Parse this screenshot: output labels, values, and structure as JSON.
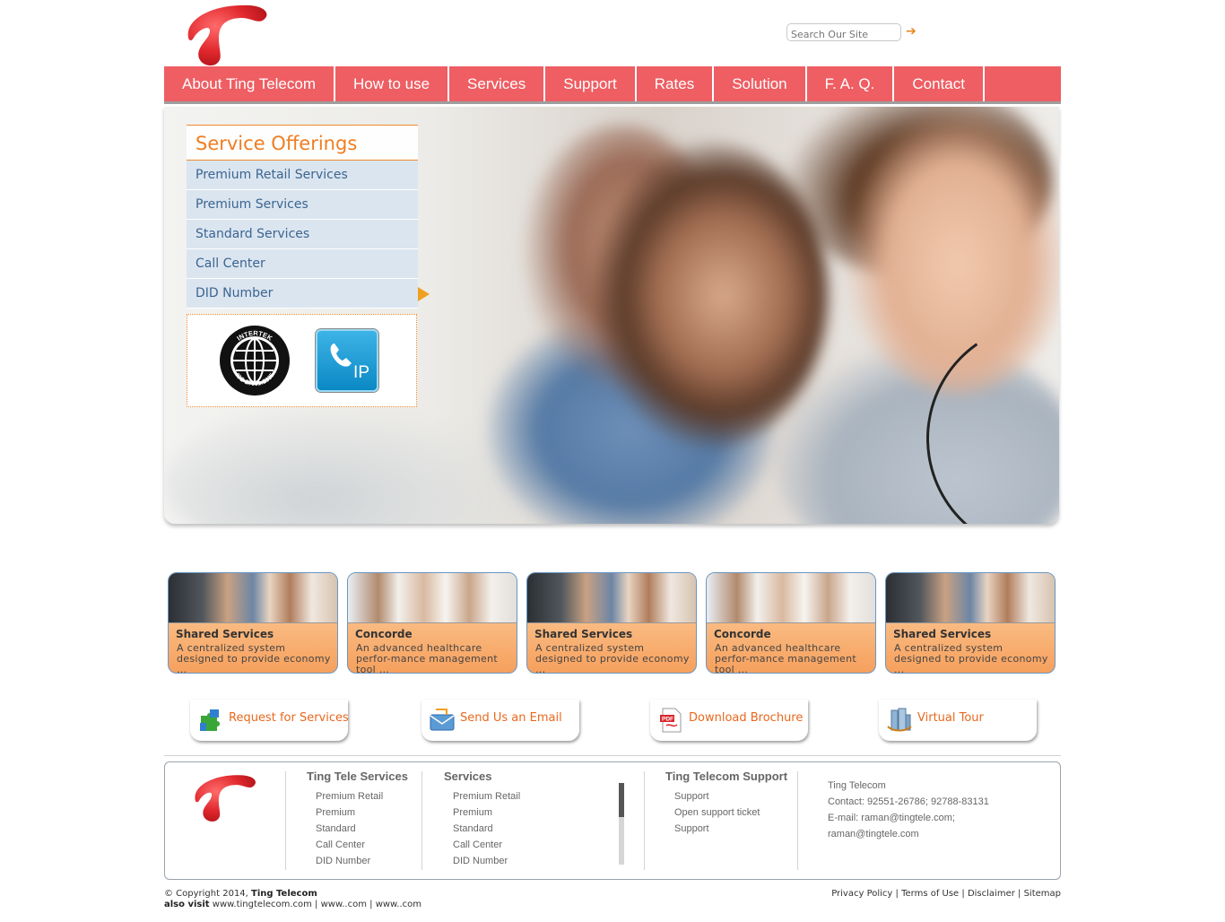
{
  "header": {
    "search_placeholder": "Search Our Site",
    "search_go_icon": "arrow-right-icon"
  },
  "nav": {
    "items": [
      "About Ting Telecom",
      "How to use",
      "Services",
      "Support",
      "Rates",
      "Solution",
      "F. A. Q.",
      "Contact"
    ]
  },
  "offerings": {
    "title": "Service Offerings",
    "items": [
      "Premium Retail Services",
      "Premium Services",
      "Standard Services",
      "Call Center",
      "DID Number"
    ],
    "badges": {
      "iso_text_top": "INTERTEK",
      "iso_text_bottom": "ISO 27001:2005",
      "ip_text": "IP"
    }
  },
  "cards": [
    {
      "title": "Shared Services",
      "desc": "A centralized system designed to provide economy ..."
    },
    {
      "title": "Concorde",
      "desc": "An advanced healthcare perfor-mance management tool ..."
    },
    {
      "title": "Shared Services",
      "desc": "A centralized system designed to provide economy ..."
    },
    {
      "title": "Concorde",
      "desc": "An advanced healthcare perfor-mance management tool ..."
    },
    {
      "title": "Shared Services",
      "desc": "A centralized system designed to provide economy ..."
    }
  ],
  "actions": [
    {
      "label": "Request for Services",
      "icon": "puzzle-icon"
    },
    {
      "label": "Send Us an Email",
      "icon": "envelope-icon"
    },
    {
      "label": "Download Brochure",
      "icon": "pdf-icon"
    },
    {
      "label": "Virtual Tour",
      "icon": "buildings-icon"
    }
  ],
  "footer": {
    "col1": {
      "head": "Ting Tele Services",
      "links": [
        "Premium Retail",
        "Premium",
        "Standard",
        "Call Center",
        "DID Number"
      ]
    },
    "col2": {
      "head": "Services",
      "links": [
        "Premium Retail",
        "Premium",
        "Standard",
        "Call Center",
        "DID Number"
      ]
    },
    "col3": {
      "head": "Ting Telecom Support",
      "links": [
        "Support",
        "Open support ticket",
        "Support"
      ]
    },
    "contact": [
      "Ting Telecom",
      "Contact: 92551-26786; 92788-83131",
      "E-mail: raman@tingtele.com;",
      "raman@tingtele.com"
    ]
  },
  "bottom": {
    "copyright_prefix": "© Copyright 2014,",
    "copyright_name": "Ting Telecom",
    "also_visit": "also visit",
    "links": [
      "www.tingtelecom.com",
      "www..com",
      "www..com"
    ],
    "legal": [
      "Privacy Policy",
      "Terms of Use",
      "Disclaimer",
      "Sitemap"
    ]
  },
  "colors": {
    "nav_bg": "#ee5e63",
    "accent_orange": "#f07d22",
    "offer_item_bg": "#dbe5f0",
    "logo_red": "#e0282d"
  }
}
